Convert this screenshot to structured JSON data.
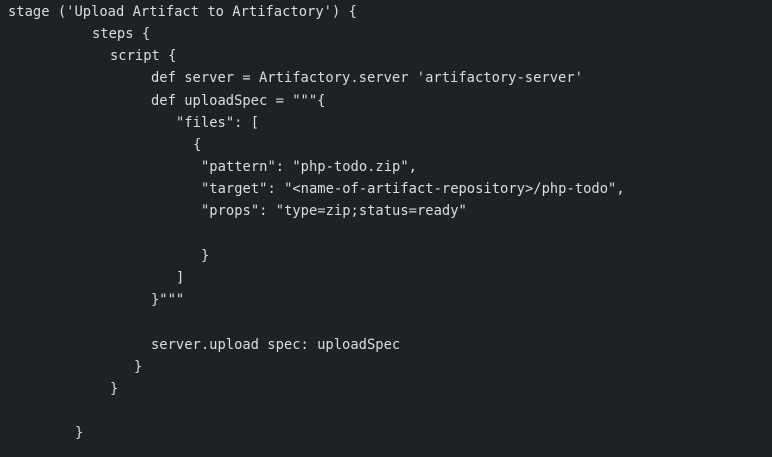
{
  "code": {
    "language": "groovy",
    "lines": [
      "stage ('Upload Artifact to Artifactory') {",
      "steps {",
      "script {",
      "def server = Artifactory.server 'artifactory-server'",
      "def uploadSpec = \"\"\"{",
      "\"files\": [",
      "{",
      "\"pattern\": \"php-todo.zip\",",
      "\"target\": \"<name-of-artifact-repository>/php-todo\",",
      "\"props\": \"type=zip;status=ready\"",
      "}",
      "]",
      "}\"\"\"",
      "server.upload spec: uploadSpec",
      "}",
      "}",
      "}"
    ]
  }
}
